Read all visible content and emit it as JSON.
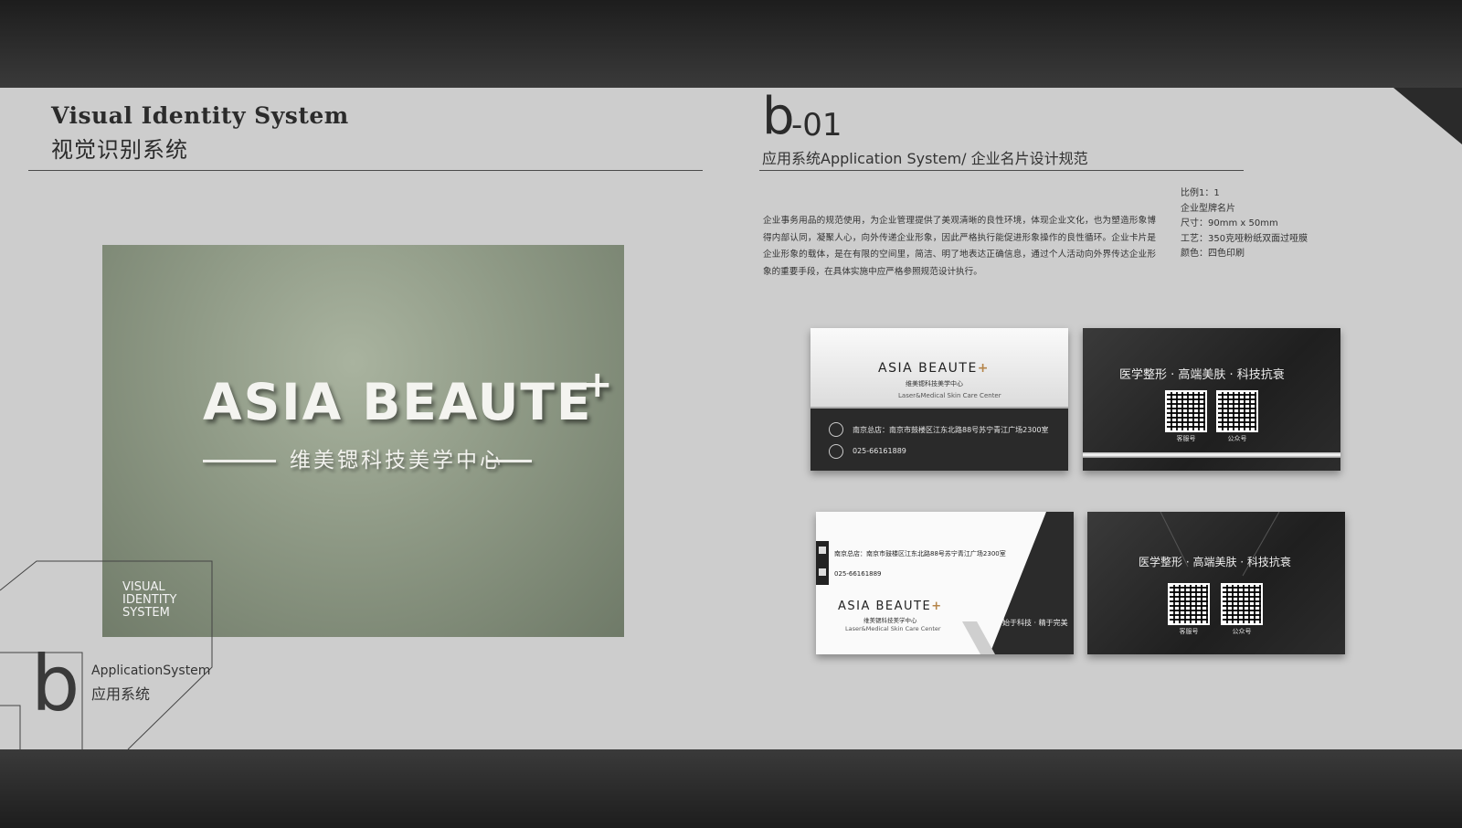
{
  "header": {
    "title_en": "Visual Identity System",
    "title_cn": "视觉识别系统",
    "code_letter": "b",
    "code_number": "-01",
    "subtitle": "应用系统Application System/ 企业名片设计规范"
  },
  "description": "企业事务用品的规范使用，为企业管理提供了美观清晰的良性环境，体现企业文化，也为塑造形象博得内部认同，凝聚人心，向外传递企业形象，因此严格执行能促进形象操作的良性循环。企业卡片是企业形象的载体，是在有限的空间里，简洁、明了地表达正确信息，通过个人活动向外界传达企业形象的重要手段，在具体实施中应严格参照规范设计执行。",
  "spec": {
    "ratio": "比例1：1",
    "type": "企业型牌名片",
    "size": "尺寸：90mm x 50mm",
    "craft": "工艺：350克哑粉纸双面过哑膜",
    "color": "颜色：四色印刷"
  },
  "sign": {
    "brand": "ASIA BEAUTE",
    "plus": "+",
    "subtitle_cn": "维美锶科技美学中心",
    "watermark": [
      "VISUAL",
      "IDENTITY",
      "SYSTEM"
    ]
  },
  "section": {
    "letter": "b",
    "label_en": "ApplicationSystem",
    "label_cn": "应用系统"
  },
  "cards": {
    "brand": "ASIA BEAUTE",
    "plus": "+",
    "brand_cn": "维美锶科技美学中心",
    "brand_en": "Laser&Medical Skin Care Center",
    "address": "南京总店：南京市鼓楼区江东北路88号苏宁青江广场2300室",
    "phone": "025-66161889",
    "tagline": "医学整形 · 高端美肤 · 科技抗衰",
    "qr_1_label": "客服号",
    "qr_2_label": "公众号",
    "slogan": "始于科技 · 精于完美"
  },
  "colors": {
    "panel": "#cdcdcd",
    "dark": "#2a2a2a",
    "accent": "#b5854a"
  }
}
